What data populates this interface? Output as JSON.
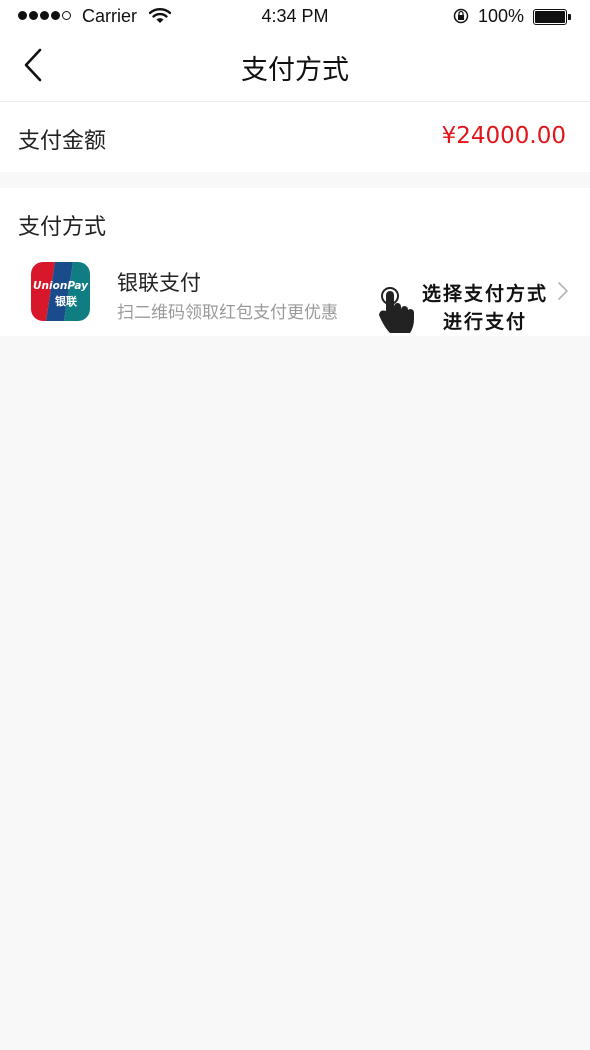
{
  "status_bar": {
    "carrier": "Carrier",
    "time": "4:34 PM",
    "battery": "100%"
  },
  "nav": {
    "title": "支付方式",
    "back_icon": "back-chevron-icon"
  },
  "amount": {
    "label": "支付金额",
    "value": "¥24000.00",
    "color": "#e0161b"
  },
  "payment_methods": {
    "header": "支付方式",
    "items": [
      {
        "name": "银联支付",
        "description": "扫二维码领取红包支付更优惠",
        "icon": "unionpay-logo",
        "logo_text": "UnionPay",
        "logo_text_cn": "银联"
      }
    ]
  },
  "annotation": {
    "line1": "选择支付方式",
    "line2": "进行支付",
    "icon": "pointing-hand-icon"
  }
}
